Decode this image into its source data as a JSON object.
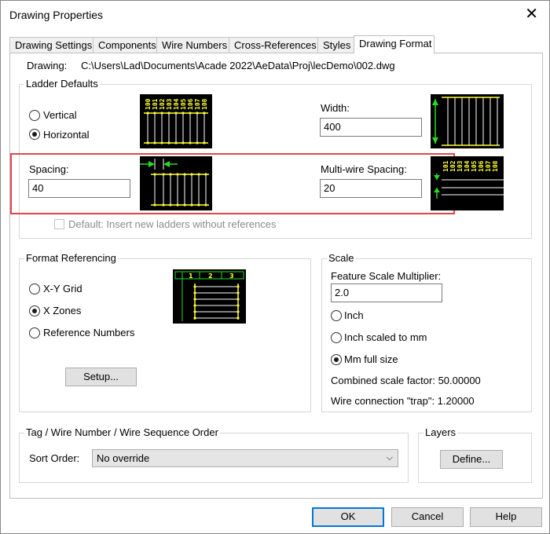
{
  "window": {
    "title": "Drawing Properties"
  },
  "tabs": [
    "Drawing Settings",
    "Components",
    "Wire Numbers",
    "Cross-References",
    "Styles",
    "Drawing Format"
  ],
  "drawing": {
    "label": "Drawing:",
    "path": "C:\\Users\\Lad\\Documents\\Acade 2022\\AeData\\Proj\\lecDemo\\002.dwg"
  },
  "ladder_defaults": {
    "title": "Ladder Defaults",
    "vertical": "Vertical",
    "horizontal": "Horizontal",
    "selected": "Horizontal",
    "width_label": "Width:",
    "width_value": "400",
    "spacing_label": "Spacing:",
    "spacing_value": "40",
    "multiwire_label": "Multi-wire Spacing:",
    "multiwire_value": "20",
    "default_checkbox": "Default: Insert new ladders without references",
    "ref_numbers": [
      "100",
      "101",
      "102",
      "103",
      "104",
      "105",
      "106",
      "107",
      "108"
    ]
  },
  "format_referencing": {
    "title": "Format Referencing",
    "options": [
      "X-Y Grid",
      "X Zones",
      "Reference Numbers"
    ],
    "selected": "X Zones",
    "setup_label": "Setup...",
    "zones": [
      "1",
      "2",
      "3"
    ]
  },
  "scale": {
    "title": "Scale",
    "multiplier_label": "Feature Scale Multiplier:",
    "multiplier_value": "2.0",
    "options": [
      "Inch",
      "Inch scaled to mm",
      "Mm full size"
    ],
    "selected": "Mm full size",
    "combined": "Combined scale factor: 50.00000",
    "trap": "Wire connection \"trap\": 1.20000"
  },
  "sequence": {
    "title": "Tag / Wire Number / Wire Sequence Order",
    "sort_label": "Sort Order:",
    "sort_value": "No override"
  },
  "layers": {
    "title": "Layers",
    "define_label": "Define..."
  },
  "footer": {
    "ok": "OK",
    "cancel": "Cancel",
    "help": "Help"
  },
  "colors": {
    "accent": "#0078d7",
    "highlight": "#e0454d",
    "ladder_yellow": "#ffff33",
    "arrow_green": "#22dd22"
  },
  "icons": {
    "close": "close-icon",
    "dropdown": "chevron-down-icon"
  }
}
